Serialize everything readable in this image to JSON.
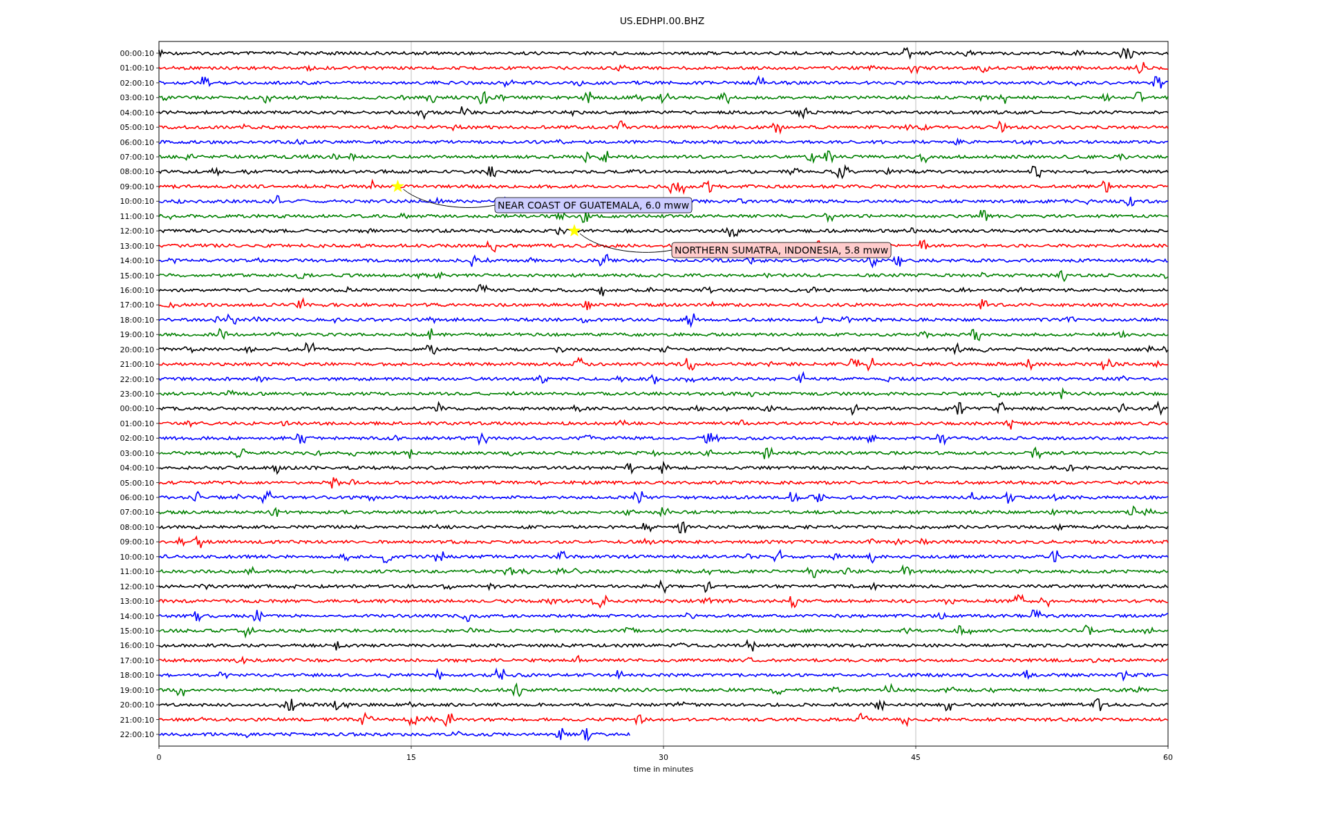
{
  "title": "US.EDHPI.00.BHZ",
  "plot": {
    "xlabel": "time in minutes",
    "xticks": [
      "0",
      "15",
      "30",
      "45",
      "60"
    ],
    "traces": [
      {
        "label": "00:00:10",
        "color": "#000000"
      },
      {
        "label": "01:00:10",
        "color": "#ff0000"
      },
      {
        "label": "02:00:10",
        "color": "#0000ff"
      },
      {
        "label": "03:00:10",
        "color": "#008000"
      },
      {
        "label": "04:00:10",
        "color": "#000000"
      },
      {
        "label": "05:00:10",
        "color": "#ff0000"
      },
      {
        "label": "06:00:10",
        "color": "#0000ff"
      },
      {
        "label": "07:00:10",
        "color": "#008000"
      },
      {
        "label": "08:00:10",
        "color": "#000000"
      },
      {
        "label": "09:00:10",
        "color": "#ff0000"
      },
      {
        "label": "10:00:10",
        "color": "#0000ff"
      },
      {
        "label": "11:00:10",
        "color": "#008000"
      },
      {
        "label": "12:00:10",
        "color": "#000000"
      },
      {
        "label": "13:00:10",
        "color": "#ff0000"
      },
      {
        "label": "14:00:10",
        "color": "#0000ff"
      },
      {
        "label": "15:00:10",
        "color": "#008000"
      },
      {
        "label": "16:00:10",
        "color": "#000000"
      },
      {
        "label": "17:00:10",
        "color": "#ff0000"
      },
      {
        "label": "18:00:10",
        "color": "#0000ff"
      },
      {
        "label": "19:00:10",
        "color": "#008000"
      },
      {
        "label": "20:00:10",
        "color": "#000000"
      },
      {
        "label": "21:00:10",
        "color": "#ff0000"
      },
      {
        "label": "22:00:10",
        "color": "#0000ff"
      },
      {
        "label": "23:00:10",
        "color": "#008000"
      },
      {
        "label": "00:00:10",
        "color": "#000000"
      },
      {
        "label": "01:00:10",
        "color": "#ff0000"
      },
      {
        "label": "02:00:10",
        "color": "#0000ff"
      },
      {
        "label": "03:00:10",
        "color": "#008000"
      },
      {
        "label": "04:00:10",
        "color": "#000000"
      },
      {
        "label": "05:00:10",
        "color": "#ff0000"
      },
      {
        "label": "06:00:10",
        "color": "#0000ff"
      },
      {
        "label": "07:00:10",
        "color": "#008000"
      },
      {
        "label": "08:00:10",
        "color": "#000000"
      },
      {
        "label": "09:00:10",
        "color": "#ff0000"
      },
      {
        "label": "10:00:10",
        "color": "#0000ff"
      },
      {
        "label": "11:00:10",
        "color": "#008000"
      },
      {
        "label": "12:00:10",
        "color": "#000000"
      },
      {
        "label": "13:00:10",
        "color": "#ff0000"
      },
      {
        "label": "14:00:10",
        "color": "#0000ff"
      },
      {
        "label": "15:00:10",
        "color": "#008000"
      },
      {
        "label": "16:00:10",
        "color": "#000000"
      },
      {
        "label": "17:00:10",
        "color": "#ff0000"
      },
      {
        "label": "18:00:10",
        "color": "#0000ff"
      },
      {
        "label": "19:00:10",
        "color": "#008000"
      },
      {
        "label": "20:00:10",
        "color": "#000000"
      },
      {
        "label": "21:00:10",
        "color": "#ff0000"
      },
      {
        "label": "22:00:10",
        "color": "#0000ff"
      }
    ],
    "events": [
      {
        "label": "NEAR COAST OF GUATEMALA, 6.0 mww",
        "color": "#ccccff"
      },
      {
        "label": "NORTHERN SUMATRA, INDONESIA, 5.8 mww",
        "color": "#ffcccc"
      }
    ]
  }
}
